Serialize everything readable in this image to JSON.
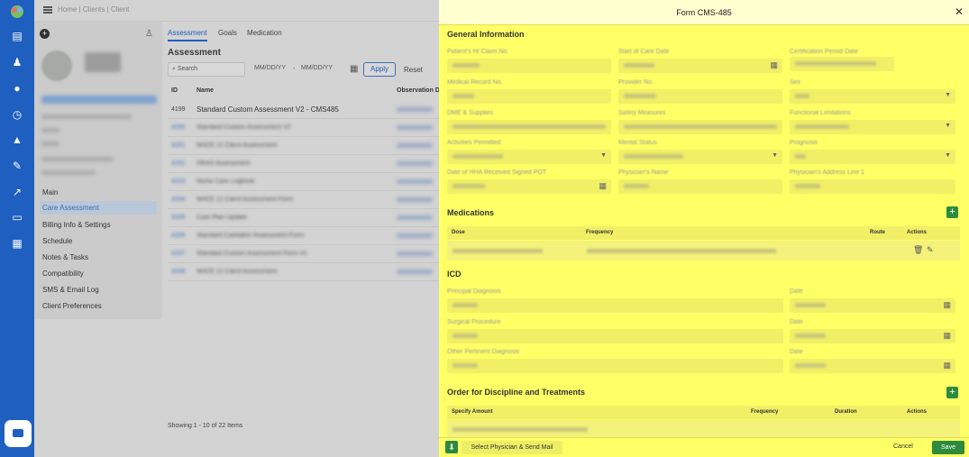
{
  "breadcrumb": "Home | Clients | Client",
  "sidebar_menu": [
    "Main",
    "Care Assessment",
    "Billing Info & Settings",
    "Schedule",
    "Notes & Tasks",
    "Compatibility",
    "SMS & Email Log",
    "Client Preferences"
  ],
  "tabs": [
    "Assessment",
    "Goals",
    "Medication"
  ],
  "section_title": "Assessment",
  "search": {
    "placeholder": "Search"
  },
  "date_from": "MM/DD/YY",
  "date_to": "MM/DD/YY",
  "apply_label": "Apply",
  "reset_label": "Reset",
  "table": {
    "headers": [
      "ID",
      "Name",
      "Observation D"
    ],
    "first_row": {
      "id": "4199",
      "name": "Standard Custom Assessment V2 - CMS485"
    }
  },
  "showing": "Showing 1 - 10 of 22 Items",
  "modal": {
    "title": "Form CMS-485",
    "general_title": "General Information",
    "general_labels": [
      "Patient's HI Claim No.",
      "Start of Care Date",
      "Certification Period Date",
      "Medical Record No.",
      "Provider No.",
      "Sex",
      "DME & Supplies",
      "Safety Measures",
      "Functional Limitations",
      "Activities Permitted",
      "Mental Status",
      "Prognosis",
      "Date of HHA Received Signed POT",
      "Physician's Name",
      "Physician's Address Line 1"
    ],
    "medications_title": "Medications",
    "med_headers": {
      "dose": "Dose",
      "frequency": "Frequency",
      "route": "Route",
      "actions": "Actions"
    },
    "icd_title": "ICD",
    "icd_labels": [
      "Principal Diagnosis",
      "Surgical Procedure",
      "Other Pertinent Diagnosis"
    ],
    "icd_date_label": "Date",
    "order_title": "Order for Discipline and Treatments",
    "order_headers": {
      "specify": "Specify Amount",
      "frequency": "Frequency",
      "duration": "Duration",
      "actions": "Actions"
    },
    "footer": {
      "send": "Select Physician & Send Mail",
      "cancel": "Cancel",
      "save": "Save"
    }
  },
  "colors": {
    "rail": "#1f5fbf",
    "modal_highlight": "#ffff66",
    "accent_green": "#2e8b3e"
  }
}
